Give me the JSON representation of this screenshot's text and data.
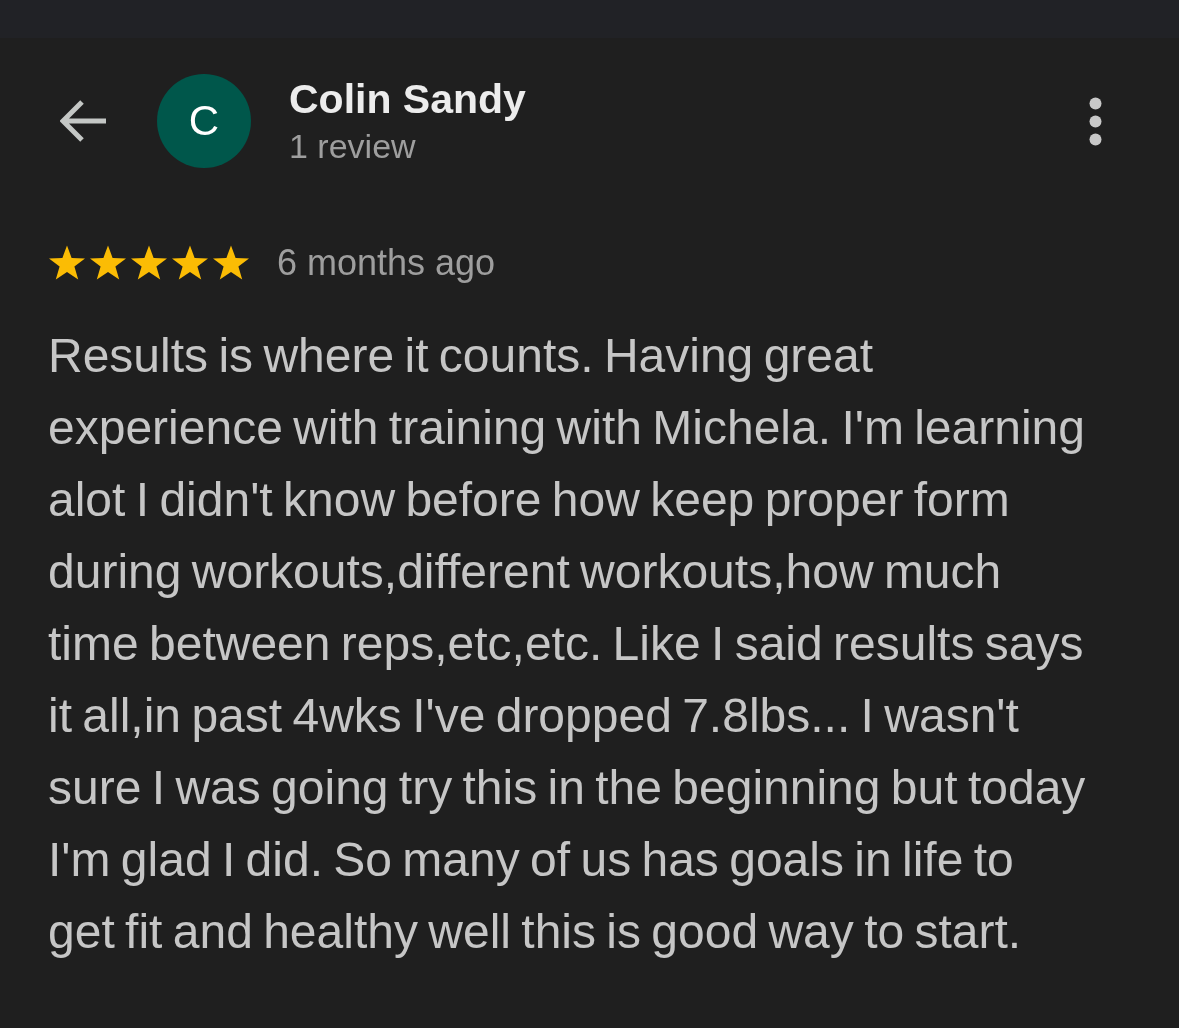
{
  "reviewer": {
    "initial": "C",
    "name": "Colin Sandy",
    "review_count": "1 review"
  },
  "review": {
    "stars": 5,
    "time": "6 months ago",
    "text": "Results is where it counts. Having great experience with training with Michela. I'm learning alot I didn't know before how keep proper form during workouts,different workouts,how much time between reps,etc,etc. Like I said results says it all,in past 4wks I've dropped 7.8lbs... I wasn't sure I was going try this in the beginning but today I'm glad I did. So many of us has goals in life to get fit and healthy well this is good way to start."
  }
}
